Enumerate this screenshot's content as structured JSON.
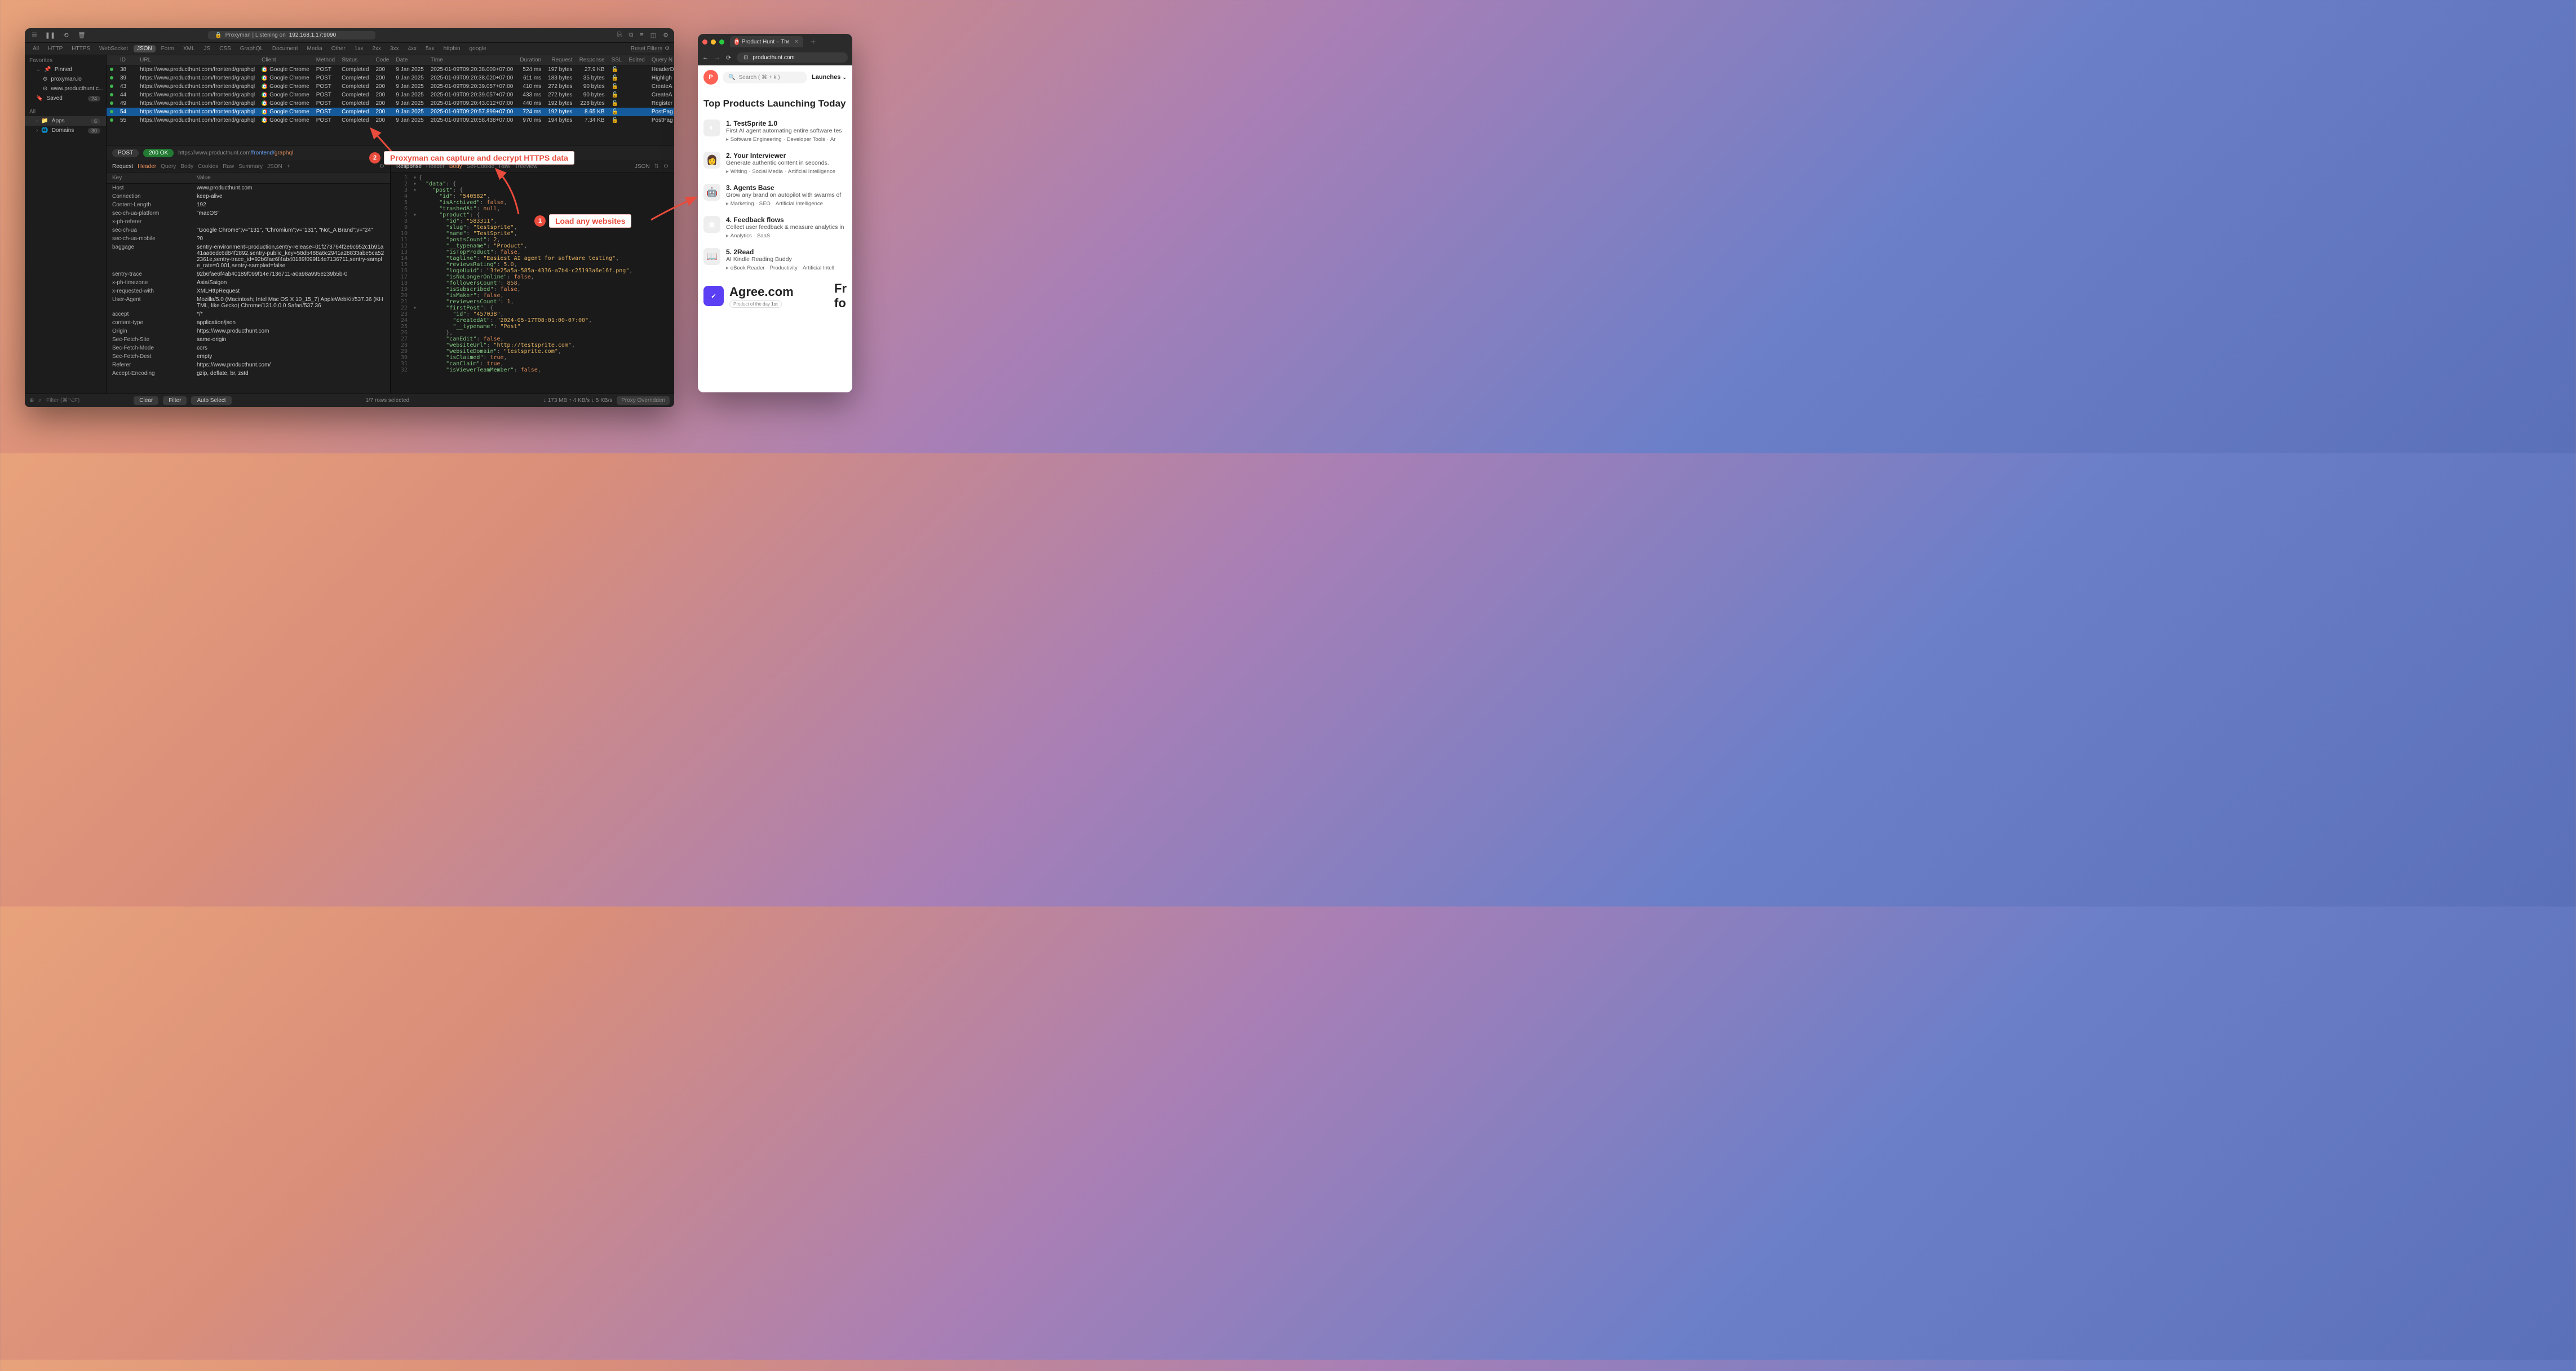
{
  "titlebar": {
    "title_prefix": "Proxyman | Listening on ",
    "listen_addr": "192.168.1.17:9090"
  },
  "filterbar": {
    "items": [
      "All",
      "HTTP",
      "HTTPS",
      "WebSocket",
      "JSON",
      "Form",
      "XML",
      "JS",
      "CSS",
      "GraphQL",
      "Document",
      "Media",
      "Other",
      "1xx",
      "2xx",
      "3xx",
      "4xx",
      "5xx",
      "httpbin",
      "google"
    ],
    "active_index": 4,
    "reset": "Reset Filters"
  },
  "sidebar": {
    "favorites": "Favorites",
    "pinned": "Pinned",
    "pinned_items": [
      "proxyman.io",
      "www.producthunt.c..."
    ],
    "saved": "Saved",
    "saved_count": "24",
    "all": "All",
    "apps": "Apps",
    "apps_count": "6",
    "domains": "Domains",
    "domains_count": "30"
  },
  "columns": [
    "",
    "ID",
    "",
    "URL",
    "Client",
    "Method",
    "Status",
    "Code",
    "Date",
    "Time",
    "Duration",
    "Request",
    "Response",
    "SSL",
    "Edited",
    "Query N"
  ],
  "rows": [
    {
      "id": "38",
      "url": "https://www.producthunt.com/frontend/graphql",
      "client": "Google Chrome",
      "method": "POST",
      "status": "Completed",
      "code": "200",
      "date": "9 Jan 2025",
      "time": "2025-01-09T09:20:38.009+07:00",
      "duration": "524 ms",
      "req": "197 bytes",
      "resp": "27.9 KB",
      "query": "HeaderD"
    },
    {
      "id": "39",
      "url": "https://www.producthunt.com/frontend/graphql",
      "client": "Google Chrome",
      "method": "POST",
      "status": "Completed",
      "code": "200",
      "date": "9 Jan 2025",
      "time": "2025-01-09T09:20:38.020+07:00",
      "duration": "611 ms",
      "req": "183 bytes",
      "resp": "35 bytes",
      "query": "Highligh"
    },
    {
      "id": "43",
      "url": "https://www.producthunt.com/frontend/graphql",
      "client": "Google Chrome",
      "method": "POST",
      "status": "Completed",
      "code": "200",
      "date": "9 Jan 2025",
      "time": "2025-01-09T09:20:39.057+07:00",
      "duration": "410 ms",
      "req": "272 bytes",
      "resp": "90 bytes",
      "query": "CreateA"
    },
    {
      "id": "44",
      "url": "https://www.producthunt.com/frontend/graphql",
      "client": "Google Chrome",
      "method": "POST",
      "status": "Completed",
      "code": "200",
      "date": "9 Jan 2025",
      "time": "2025-01-09T09:20:39.057+07:00",
      "duration": "433 ms",
      "req": "272 bytes",
      "resp": "90 bytes",
      "query": "CreateA"
    },
    {
      "id": "49",
      "url": "https://www.producthunt.com/frontend/graphql",
      "client": "Google Chrome",
      "method": "POST",
      "status": "Completed",
      "code": "200",
      "date": "9 Jan 2025",
      "time": "2025-01-09T09:20:43.012+07:00",
      "duration": "440 ms",
      "req": "192 bytes",
      "resp": "228 bytes",
      "query": "Register"
    },
    {
      "id": "54",
      "url": "https://www.producthunt.com/frontend/graphql",
      "client": "Google Chrome",
      "method": "POST",
      "status": "Completed",
      "code": "200",
      "date": "9 Jan 2025",
      "time": "2025-01-09T09:20:57.899+07:00",
      "duration": "724 ms",
      "req": "192 bytes",
      "resp": "8.65 KB",
      "query": "PostPag",
      "sel": true
    },
    {
      "id": "55",
      "url": "https://www.producthunt.com/frontend/graphql",
      "client": "Google Chrome",
      "method": "POST",
      "status": "Completed",
      "code": "200",
      "date": "9 Jan 2025",
      "time": "2025-01-09T09:20:58.438+07:00",
      "duration": "970 ms",
      "req": "194 bytes",
      "resp": "7.34 KB",
      "query": "PostPag"
    }
  ],
  "detail": {
    "method": "POST",
    "status_pill": "200 OK",
    "url_gray": "https://www.producthunt.com",
    "url_path": "/frontend/",
    "url_last": "graphql"
  },
  "req_tabs": {
    "label": "Request",
    "items": [
      "Header",
      "Query",
      "Body",
      "Cookies",
      "Raw",
      "Summary",
      "JSON",
      "+"
    ],
    "active": 0
  },
  "resp_tabs": {
    "label": "Response",
    "items": [
      "Header",
      "Body",
      "Set-Cookie",
      "Raw",
      "Treeview"
    ],
    "active": 1,
    "right": "JSON"
  },
  "kv_header": {
    "key": "Key",
    "value": "Value"
  },
  "headers": [
    {
      "k": "Host",
      "v": "www.producthunt.com"
    },
    {
      "k": "Connection",
      "v": "keep-alive"
    },
    {
      "k": "Content-Length",
      "v": "192"
    },
    {
      "k": "sec-ch-ua-platform",
      "v": "\"macOS\""
    },
    {
      "k": "x-ph-referer",
      "v": ""
    },
    {
      "k": "sec-ch-ua",
      "v": "\"Google Chrome\";v=\"131\", \"Chromium\";v=\"131\", \"Not_A Brand\";v=\"24\""
    },
    {
      "k": "sec-ch-ua-mobile",
      "v": "?0"
    },
    {
      "k": "baggage",
      "v": "sentry-environment=production,sentry-release=01f273764f2e9c952c1b91a41aa6edc6d84f2892,sentry-public_key=58db488a6c2941a28833abe5ca522361e,sentry-trace_id=92b6fae6f4ab40189f099f14e7136711,sentry-sample_rate=0.001,sentry-sampled=false"
    },
    {
      "k": "sentry-trace",
      "v": "92b6fae6f4ab40189f099f14e7136711-a0a98a995e239b5b-0"
    },
    {
      "k": "x-ph-timezone",
      "v": "Asia/Saigon"
    },
    {
      "k": "x-requested-with",
      "v": "XMLHttpRequest"
    },
    {
      "k": "User-Agent",
      "v": "Mozilla/5.0 (Macintosh; Intel Mac OS X 10_15_7) AppleWebKit/537.36 (KHTML, like Gecko) Chrome/131.0.0.0 Safari/537.36"
    },
    {
      "k": "accept",
      "v": "*/*"
    },
    {
      "k": "content-type",
      "v": "application/json"
    },
    {
      "k": "Origin",
      "v": "https://www.producthunt.com"
    },
    {
      "k": "Sec-Fetch-Site",
      "v": "same-origin"
    },
    {
      "k": "Sec-Fetch-Mode",
      "v": "cors"
    },
    {
      "k": "Sec-Fetch-Dest",
      "v": "empty"
    },
    {
      "k": "Referer",
      "v": "https://www.producthunt.com/"
    },
    {
      "k": "Accept-Encoding",
      "v": "gzip, deflate, br, zstd"
    }
  ],
  "json_lines": [
    {
      "n": 1,
      "caret": "▾",
      "ind": 0,
      "txt": [
        [
          "jp",
          "{"
        ]
      ]
    },
    {
      "n": 2,
      "caret": "▾",
      "ind": 1,
      "txt": [
        [
          "jk",
          "\"data\""
        ],
        [
          "jp",
          ": {"
        ]
      ]
    },
    {
      "n": 3,
      "caret": "▾",
      "ind": 2,
      "txt": [
        [
          "jk",
          "\"post\""
        ],
        [
          "jp",
          ": {"
        ]
      ]
    },
    {
      "n": 4,
      "caret": "",
      "ind": 3,
      "txt": [
        [
          "jk",
          "\"id\""
        ],
        [
          "jp",
          ": "
        ],
        [
          "js",
          "\"540582\""
        ],
        [
          "jp",
          ","
        ]
      ]
    },
    {
      "n": 5,
      "caret": "",
      "ind": 3,
      "txt": [
        [
          "jk",
          "\"isArchived\""
        ],
        [
          "jp",
          ": "
        ],
        [
          "jb",
          "false"
        ],
        [
          "jp",
          ","
        ]
      ]
    },
    {
      "n": 6,
      "caret": "",
      "ind": 3,
      "txt": [
        [
          "jk",
          "\"trashedAt\""
        ],
        [
          "jp",
          ": "
        ],
        [
          "jb",
          "null"
        ],
        [
          "jp",
          ","
        ]
      ]
    },
    {
      "n": 7,
      "caret": "▾",
      "ind": 3,
      "txt": [
        [
          "jk",
          "\"product\""
        ],
        [
          "jp",
          ": {"
        ]
      ]
    },
    {
      "n": 8,
      "caret": "",
      "ind": 4,
      "txt": [
        [
          "jk",
          "\"id\""
        ],
        [
          "jp",
          ": "
        ],
        [
          "js",
          "\"583311\""
        ],
        [
          "jp",
          ","
        ]
      ]
    },
    {
      "n": 9,
      "caret": "",
      "ind": 4,
      "txt": [
        [
          "jk",
          "\"slug\""
        ],
        [
          "jp",
          ": "
        ],
        [
          "js",
          "\"testsprite\""
        ],
        [
          "jp",
          ","
        ]
      ]
    },
    {
      "n": 10,
      "caret": "",
      "ind": 4,
      "txt": [
        [
          "jk",
          "\"name\""
        ],
        [
          "jp",
          ": "
        ],
        [
          "js",
          "\"TestSprite\""
        ],
        [
          "jp",
          ","
        ]
      ]
    },
    {
      "n": 11,
      "caret": "",
      "ind": 4,
      "txt": [
        [
          "jk",
          "\"postsCount\""
        ],
        [
          "jp",
          ": "
        ],
        [
          "jn",
          "2"
        ],
        [
          "jp",
          ","
        ]
      ]
    },
    {
      "n": 12,
      "caret": "",
      "ind": 4,
      "txt": [
        [
          "jk",
          "\"__typename\""
        ],
        [
          "jp",
          ": "
        ],
        [
          "js",
          "\"Product\""
        ],
        [
          "jp",
          ","
        ]
      ]
    },
    {
      "n": 13,
      "caret": "",
      "ind": 4,
      "txt": [
        [
          "jk",
          "\"isTopProduct\""
        ],
        [
          "jp",
          ": "
        ],
        [
          "jb",
          "false"
        ],
        [
          "jp",
          ","
        ]
      ]
    },
    {
      "n": 14,
      "caret": "",
      "ind": 4,
      "txt": [
        [
          "jk",
          "\"tagline\""
        ],
        [
          "jp",
          ": "
        ],
        [
          "js",
          "\"Easiest AI agent for software testing\""
        ],
        [
          "jp",
          ","
        ]
      ]
    },
    {
      "n": 15,
      "caret": "",
      "ind": 4,
      "txt": [
        [
          "jk",
          "\"reviewsRating\""
        ],
        [
          "jp",
          ": "
        ],
        [
          "jn",
          "5.0"
        ],
        [
          "jp",
          ","
        ]
      ]
    },
    {
      "n": 16,
      "caret": "",
      "ind": 4,
      "txt": [
        [
          "jk",
          "\"logoUuid\""
        ],
        [
          "jp",
          ": "
        ],
        [
          "js",
          "\"3fe25a5a-585a-4336-a7b4-c25193a6e16f.png\""
        ],
        [
          "jp",
          ","
        ]
      ]
    },
    {
      "n": 17,
      "caret": "",
      "ind": 4,
      "txt": [
        [
          "jk",
          "\"isNoLongerOnline\""
        ],
        [
          "jp",
          ": "
        ],
        [
          "jb",
          "false"
        ],
        [
          "jp",
          ","
        ]
      ]
    },
    {
      "n": 18,
      "caret": "",
      "ind": 4,
      "txt": [
        [
          "jk",
          "\"followersCount\""
        ],
        [
          "jp",
          ": "
        ],
        [
          "jn",
          "858"
        ],
        [
          "jp",
          ","
        ]
      ]
    },
    {
      "n": 19,
      "caret": "",
      "ind": 4,
      "txt": [
        [
          "jk",
          "\"isSubscribed\""
        ],
        [
          "jp",
          ": "
        ],
        [
          "jb",
          "false"
        ],
        [
          "jp",
          ","
        ]
      ]
    },
    {
      "n": 20,
      "caret": "",
      "ind": 4,
      "txt": [
        [
          "jk",
          "\"isMaker\""
        ],
        [
          "jp",
          ": "
        ],
        [
          "jb",
          "false"
        ],
        [
          "jp",
          ","
        ]
      ]
    },
    {
      "n": 21,
      "caret": "",
      "ind": 4,
      "txt": [
        [
          "jk",
          "\"reviewersCount\""
        ],
        [
          "jp",
          ": "
        ],
        [
          "jn",
          "1"
        ],
        [
          "jp",
          ","
        ]
      ]
    },
    {
      "n": 22,
      "caret": "▾",
      "ind": 4,
      "txt": [
        [
          "jk",
          "\"firstPost\""
        ],
        [
          "jp",
          ": {"
        ]
      ]
    },
    {
      "n": 23,
      "caret": "",
      "ind": 5,
      "txt": [
        [
          "jk",
          "\"id\""
        ],
        [
          "jp",
          ": "
        ],
        [
          "js",
          "\"457038\""
        ],
        [
          "jp",
          ","
        ]
      ]
    },
    {
      "n": 24,
      "caret": "",
      "ind": 5,
      "txt": [
        [
          "jk",
          "\"createdAt\""
        ],
        [
          "jp",
          ": "
        ],
        [
          "js",
          "\"2024-05-17T08:01:00-07:00\""
        ],
        [
          "jp",
          ","
        ]
      ]
    },
    {
      "n": 25,
      "caret": "",
      "ind": 5,
      "txt": [
        [
          "jk",
          "\"__typename\""
        ],
        [
          "jp",
          ": "
        ],
        [
          "js",
          "\"Post\""
        ]
      ]
    },
    {
      "n": 26,
      "caret": "",
      "ind": 4,
      "txt": [
        [
          "jp",
          "},"
        ]
      ]
    },
    {
      "n": 27,
      "caret": "",
      "ind": 4,
      "txt": [
        [
          "jk",
          "\"canEdit\""
        ],
        [
          "jp",
          ": "
        ],
        [
          "jb",
          "false"
        ],
        [
          "jp",
          ","
        ]
      ]
    },
    {
      "n": 28,
      "caret": "",
      "ind": 4,
      "txt": [
        [
          "jk",
          "\"websiteUrl\""
        ],
        [
          "jp",
          ": "
        ],
        [
          "js",
          "\"http://testsprite.com\""
        ],
        [
          "jp",
          ","
        ]
      ]
    },
    {
      "n": 29,
      "caret": "",
      "ind": 4,
      "txt": [
        [
          "jk",
          "\"websiteDomain\""
        ],
        [
          "jp",
          ": "
        ],
        [
          "js",
          "\"testsprite.com\""
        ],
        [
          "jp",
          ","
        ]
      ]
    },
    {
      "n": 30,
      "caret": "",
      "ind": 4,
      "txt": [
        [
          "jk",
          "\"isClaimed\""
        ],
        [
          "jp",
          ": "
        ],
        [
          "jb",
          "true"
        ],
        [
          "jp",
          ","
        ]
      ]
    },
    {
      "n": 31,
      "caret": "",
      "ind": 4,
      "txt": [
        [
          "jk",
          "\"canClaim\""
        ],
        [
          "jp",
          ": "
        ],
        [
          "jb",
          "true"
        ],
        [
          "jp",
          ","
        ]
      ]
    },
    {
      "n": 32,
      "caret": "",
      "ind": 4,
      "txt": [
        [
          "jk",
          "\"isViewerTeamMember\""
        ],
        [
          "jp",
          ": "
        ],
        [
          "jb",
          "false"
        ],
        [
          "jp",
          ","
        ]
      ]
    }
  ],
  "footer": {
    "filter_placeholder": "Filter (⌘⌥F)",
    "clear": "Clear",
    "filter": "Filter",
    "auto_select": "Auto Select",
    "rows_selected": "1/7 rows selected",
    "stats": "↓ 173 MB ↑ 4 KB/s ↓ 5 KB/s",
    "override": "Proxy Overridden"
  },
  "browser": {
    "tab_title": "Product Hunt – The best new",
    "url": "producthunt.com",
    "search_placeholder": "Search ( ⌘ + k )",
    "launches": "Launches",
    "headline": "Top Products Launching Today",
    "products": [
      {
        "n": "1",
        "title": "TestSprite 1.0",
        "desc": "First AI agent automating entire software tes",
        "tags": [
          "Software Engineering",
          "Developer Tools",
          "Ar"
        ],
        "thumb": "◐",
        "cls": "p-thumb-1"
      },
      {
        "n": "2",
        "title": "Your Interviewer",
        "desc": "Generate authentic content in seconds.",
        "tags": [
          "Writing",
          "Social Media",
          "Artificial Intelligence"
        ],
        "thumb": "👩",
        "cls": "p-thumb-2"
      },
      {
        "n": "3",
        "title": "Agents Base",
        "desc": "Grow any brand on autopilot with swarms of",
        "tags": [
          "Marketing",
          "SEO",
          "Artificial Intelligence"
        ],
        "thumb": "🤖",
        "cls": "p-thumb-3"
      },
      {
        "n": "4",
        "title": "Feedback flows",
        "desc": "Collect user feedback & measure analytics in",
        "tags": [
          "Analytics",
          "SaaS"
        ],
        "thumb": "◉",
        "cls": "p-thumb-4"
      },
      {
        "n": "5",
        "title": "2Read",
        "desc": "AI Kindle Reading Buddy",
        "tags": [
          "eBook Reader",
          "Productivity",
          "Artificial Intell"
        ],
        "thumb": "📖",
        "cls": "p-thumb-5"
      }
    ],
    "promo_name": "Agree.com",
    "promo_right": "Fr\nfo",
    "promo_badge": "Product of the day",
    "promo_rank": "1st"
  },
  "callouts": {
    "c1_text": "Load any websites",
    "c2_text": "Proxyman can capture and decrypt HTTPS data"
  }
}
